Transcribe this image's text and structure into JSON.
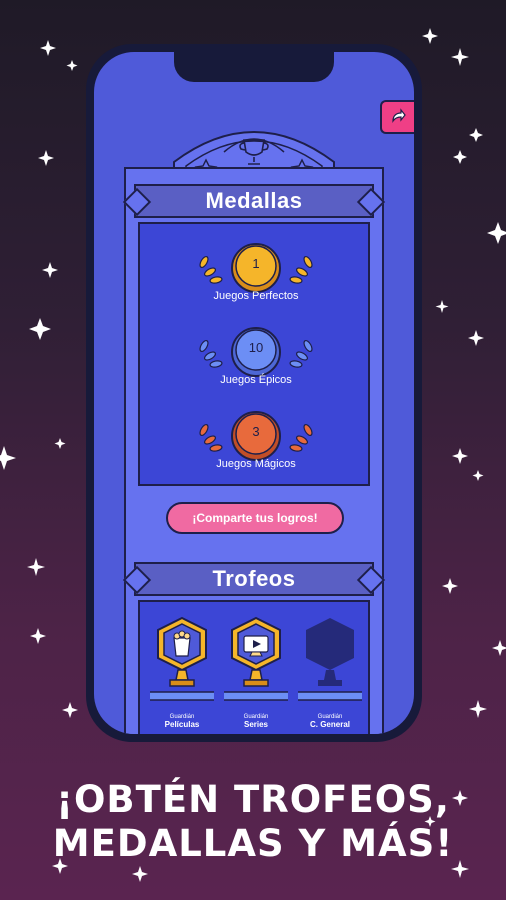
{
  "medals_panel": {
    "title": "Medallas",
    "medals": [
      {
        "count": "1",
        "label": "Juegos Perfectos",
        "color": "#f5b52a",
        "rim": "#d98d1a"
      },
      {
        "count": "10",
        "label": "Juegos Épicos",
        "color": "#6c8ef5",
        "rim": "#4d67d6"
      },
      {
        "count": "3",
        "label": "Juegos Mágicos",
        "color": "#e86a3c",
        "rim": "#c14e27"
      }
    ],
    "share_button": "¡Comparte tus logros!"
  },
  "trophies_panel": {
    "title": "Trofeos",
    "trophies": [
      {
        "top": "Guardián",
        "bottom": "Películas",
        "icon": "popcorn-icon"
      },
      {
        "top": "Guardián",
        "bottom": "Series",
        "icon": "tv-play-icon"
      },
      {
        "top": "Guardián",
        "bottom": "C. General",
        "icon": "locked-silhouette"
      }
    ]
  },
  "headline": {
    "line1": "¡OBTÉN TROFEOS,",
    "line2": "MEDALLAS Y MÁS!"
  },
  "colors": {
    "screen": "#4f5ad9",
    "accent_pink": "#ef3f86",
    "gold": "#f5b52a"
  }
}
